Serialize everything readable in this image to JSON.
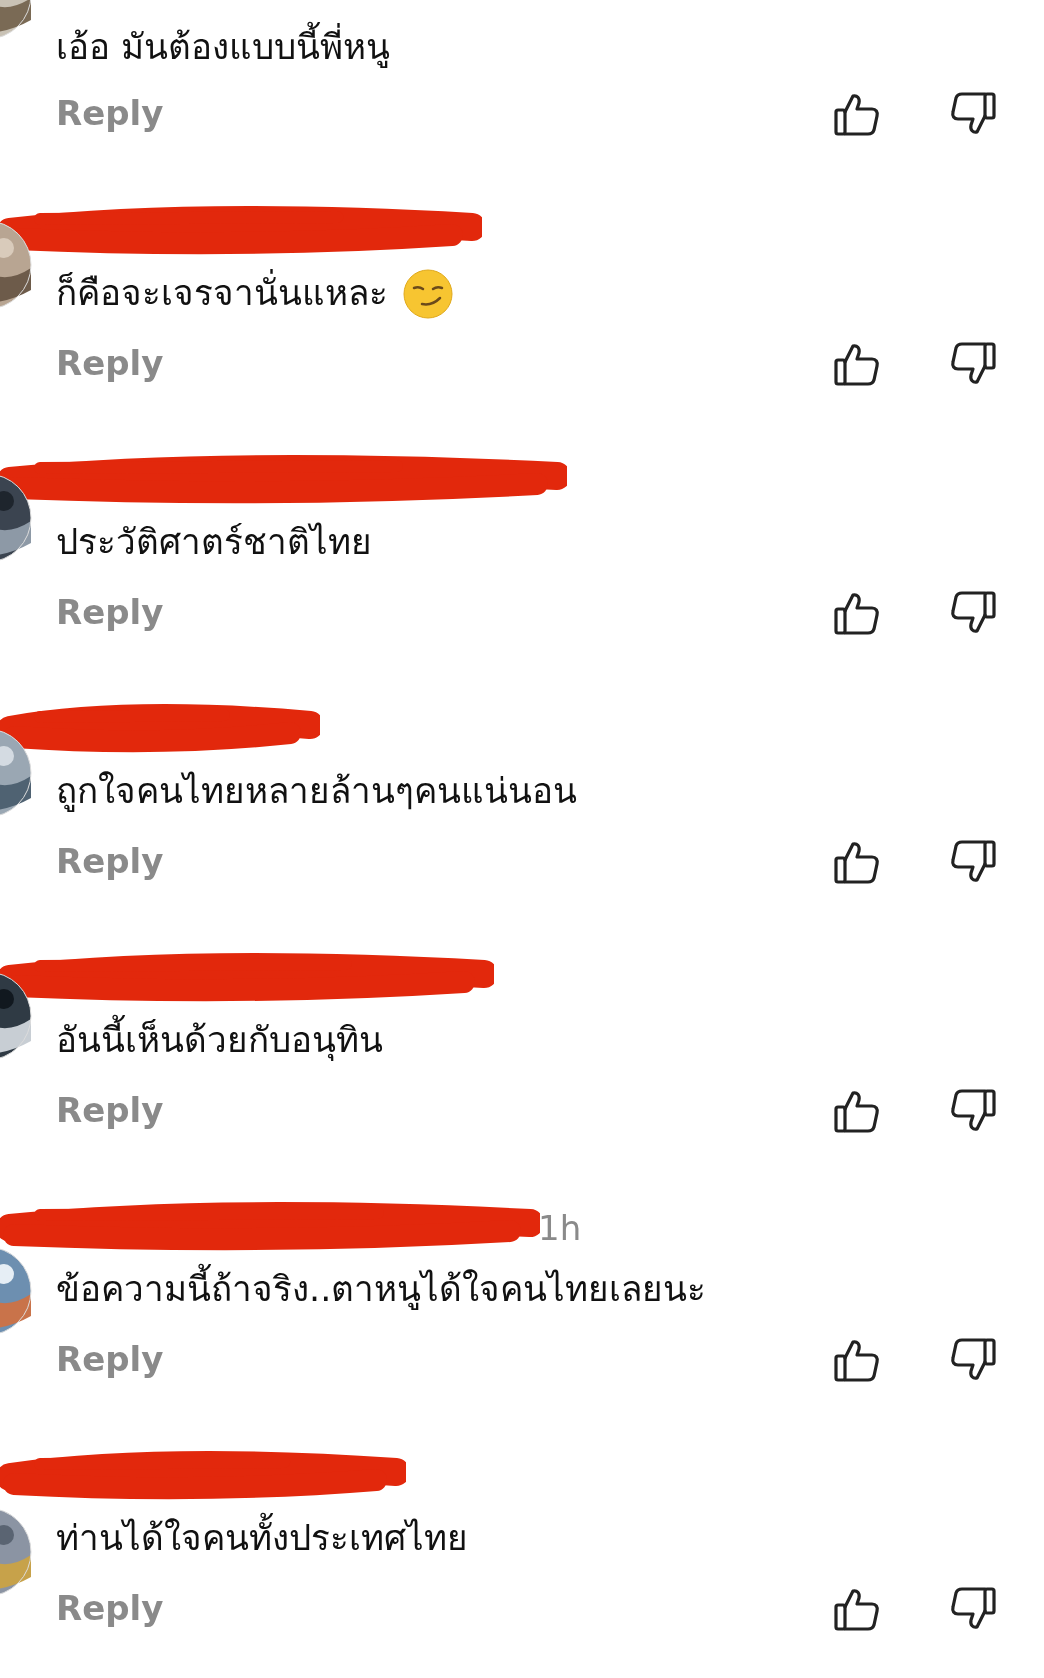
{
  "comments": [
    {
      "text": "เอ้อ มันต้องแบบนี้พี่หนู",
      "reply": "Reply"
    },
    {
      "name_redacted": true,
      "text": "ก็คือจะเจรจานั่นแหละ",
      "emoji": true,
      "reply": "Reply"
    },
    {
      "name_redacted": true,
      "text": "ประวัติศาตร์ชาติไทย",
      "reply": "Reply"
    },
    {
      "name_redacted": true,
      "text": "ถูกใจคนไทยหลายล้านๆคนแน่นอน",
      "reply": "Reply"
    },
    {
      "name_redacted": true,
      "text": "อันนี้เห็นด้วยกับอนุทิน",
      "reply": "Reply"
    },
    {
      "name_redacted": true,
      "time": "1h",
      "text": "ข้อความนี้ถ้าจริง..ตาหนูได้ใจคนไทยเลยนะ",
      "reply": "Reply"
    },
    {
      "name_redacted": true,
      "text": "ท่านได้ใจคนทั้งประเทศไทย",
      "reply": "Reply"
    }
  ]
}
